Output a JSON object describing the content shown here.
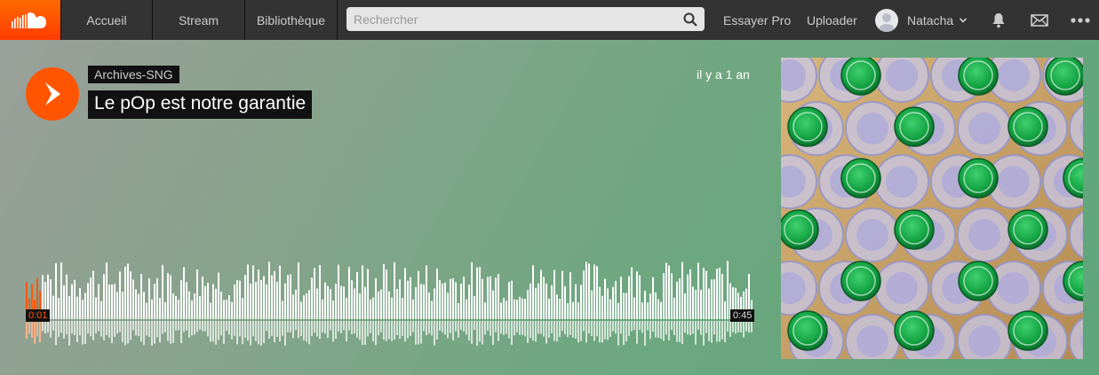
{
  "nav": {
    "home": "Accueil",
    "stream": "Stream",
    "library": "Bibliothèque",
    "search_placeholder": "Rechercher",
    "try_pro": "Essayer Pro",
    "upload": "Uploader",
    "user_name": "Natacha"
  },
  "track": {
    "artist": "Archives-SNG",
    "title": "Le pOp est notre garantie",
    "posted": "il y a 1 an",
    "current_time": "0:01",
    "duration": "0:45",
    "progress": 0.02
  },
  "colors": {
    "brand": "#ff5500",
    "topbar": "#333333"
  },
  "icons": [
    "soundcloud-logo",
    "search-icon",
    "chevron-down-icon",
    "bell-icon",
    "mail-icon",
    "more-icon",
    "play-icon"
  ]
}
